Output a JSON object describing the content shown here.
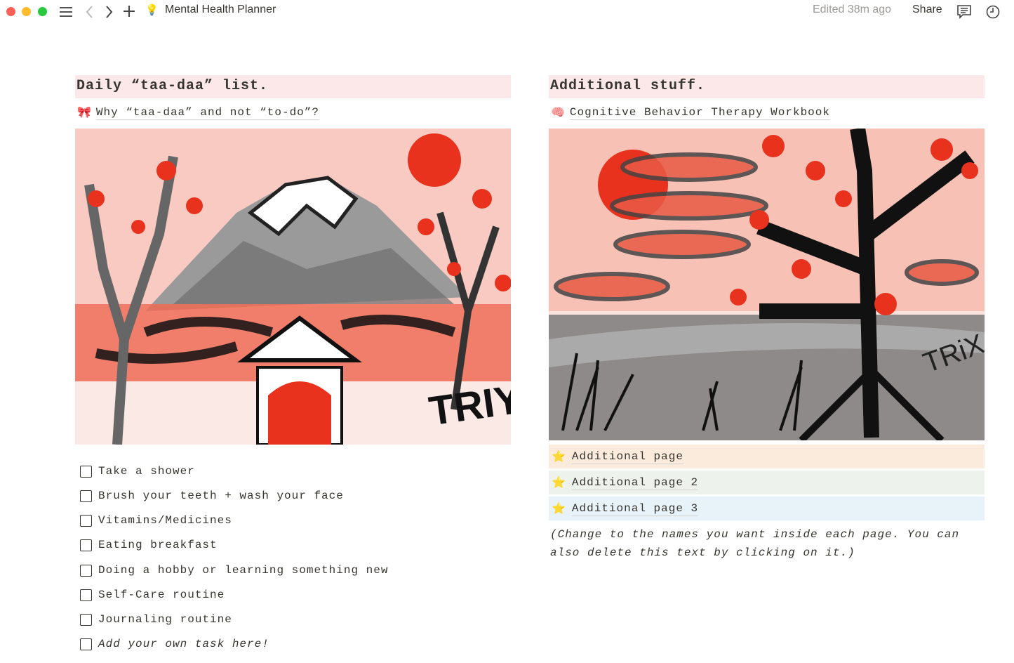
{
  "topbar": {
    "title": "Mental Health Planner",
    "edited": "Edited 38m ago",
    "share": "Share",
    "icons": [
      "menu-icon",
      "back-icon",
      "forward-icon",
      "plus-icon",
      "brain-bulb-icon",
      "comment-icon",
      "clock-icon"
    ]
  },
  "left": {
    "heading": "Daily “taa-daa” list.",
    "link_emoji": "🎀",
    "link": "Why “taa-daa” and not “to-do”?",
    "tasks": [
      {
        "label": "Take a shower",
        "checked": false
      },
      {
        "label": "Brush your teeth + wash your face",
        "checked": false
      },
      {
        "label": "Vitamins/Medicines",
        "checked": false
      },
      {
        "label": "Eating breakfast",
        "checked": false
      },
      {
        "label": "Doing a hobby or learning something new",
        "checked": false
      },
      {
        "label": "Self-Care routine",
        "checked": false
      },
      {
        "label": "Journaling routine",
        "checked": false
      },
      {
        "label": "Add your own task here!",
        "checked": false,
        "placeholder": true
      }
    ]
  },
  "right": {
    "heading": "Additional stuff.",
    "link_emoji": "🧠",
    "link": "Cognitive Behavior Therapy Workbook",
    "pages": [
      {
        "emoji": "⭐",
        "label": "Additional page",
        "color": "#fbebdd"
      },
      {
        "emoji": "⭐",
        "label": "Additional page 2",
        "color": "#edf3ec"
      },
      {
        "emoji": "⭐",
        "label": "Additional page 3",
        "color": "#e7f3f8"
      }
    ],
    "note": "(Change to the names you want inside each page. You can also delete this text by clicking on it.)"
  },
  "colors": {
    "heading_bg": "#fce8e8",
    "accent_red": "#e8321e"
  }
}
